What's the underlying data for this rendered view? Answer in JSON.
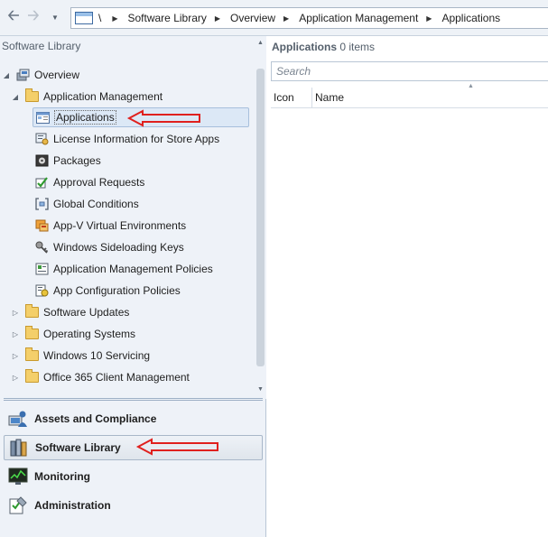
{
  "nav": {
    "back_icon": "back-arrow-icon",
    "forward_icon": "forward-arrow-icon",
    "dropdown_icon": "chevron-down-icon"
  },
  "breadcrumb": [
    "\\",
    "Software Library",
    "Overview",
    "Application Management",
    "Applications"
  ],
  "left_pane": {
    "title": "Software Library",
    "tree": [
      {
        "label": "Overview",
        "icon": "overview-icon"
      },
      {
        "label": "Application Management",
        "icon": "folder-icon"
      },
      {
        "label": "Applications",
        "icon": "applications-icon",
        "selected": true
      },
      {
        "label": "License Information for Store Apps",
        "icon": "license-icon"
      },
      {
        "label": "Packages",
        "icon": "package-icon"
      },
      {
        "label": "Approval Requests",
        "icon": "approval-icon"
      },
      {
        "label": "Global Conditions",
        "icon": "conditions-icon"
      },
      {
        "label": "App-V Virtual Environments",
        "icon": "appv-icon"
      },
      {
        "label": "Windows Sideloading Keys",
        "icon": "key-icon"
      },
      {
        "label": "Application Management Policies",
        "icon": "policy-icon"
      },
      {
        "label": "App Configuration Policies",
        "icon": "config-policy-icon"
      },
      {
        "label": "Software Updates",
        "icon": "folder-icon"
      },
      {
        "label": "Operating Systems",
        "icon": "folder-icon"
      },
      {
        "label": "Windows 10 Servicing",
        "icon": "folder-icon"
      },
      {
        "label": "Office 365 Client Management",
        "icon": "folder-icon"
      }
    ]
  },
  "workspaces": [
    {
      "label": "Assets and Compliance",
      "icon": "assets-compliance-icon"
    },
    {
      "label": "Software Library",
      "icon": "software-library-icon",
      "active": true
    },
    {
      "label": "Monitoring",
      "icon": "monitoring-icon"
    },
    {
      "label": "Administration",
      "icon": "administration-icon"
    }
  ],
  "right_pane": {
    "title": "Applications",
    "count": "0 items",
    "search_placeholder": "Search",
    "columns": [
      "Icon",
      "Name"
    ]
  },
  "colors": {
    "annotation_arrow": "#e0201e",
    "pane_background": "#eef2f8",
    "selection": "#dce8f6"
  }
}
